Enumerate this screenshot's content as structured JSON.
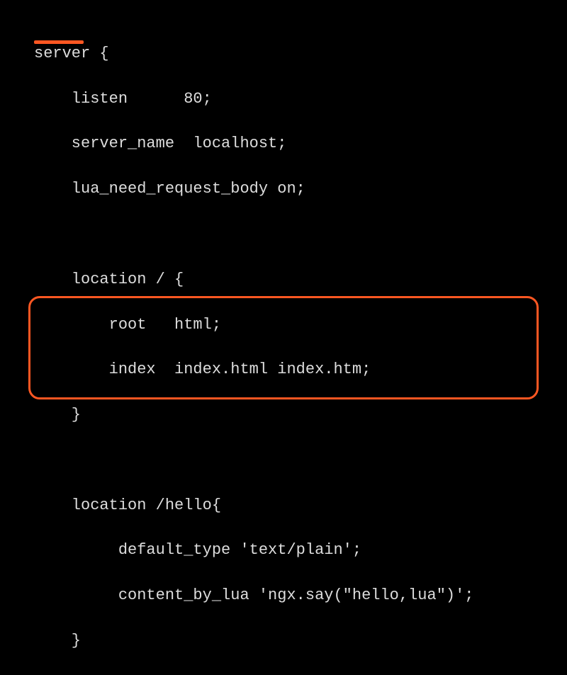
{
  "code": {
    "l1": "server {",
    "l2": "    listen      80;",
    "l3": "    server_name  localhost;",
    "l4": "    lua_need_request_body on;",
    "l5": "",
    "l6": "",
    "l7": "    location / {",
    "l8": "        root   html;",
    "l9": "        index  index.html index.htm;",
    "l10": "    }",
    "l11": "",
    "l12": "",
    "l13": "    location /hello{",
    "l14": "         default_type 'text/plain';",
    "l15": "         content_by_lua 'ngx.say(\"hello,lua\")';",
    "l16": "    }"
  }
}
